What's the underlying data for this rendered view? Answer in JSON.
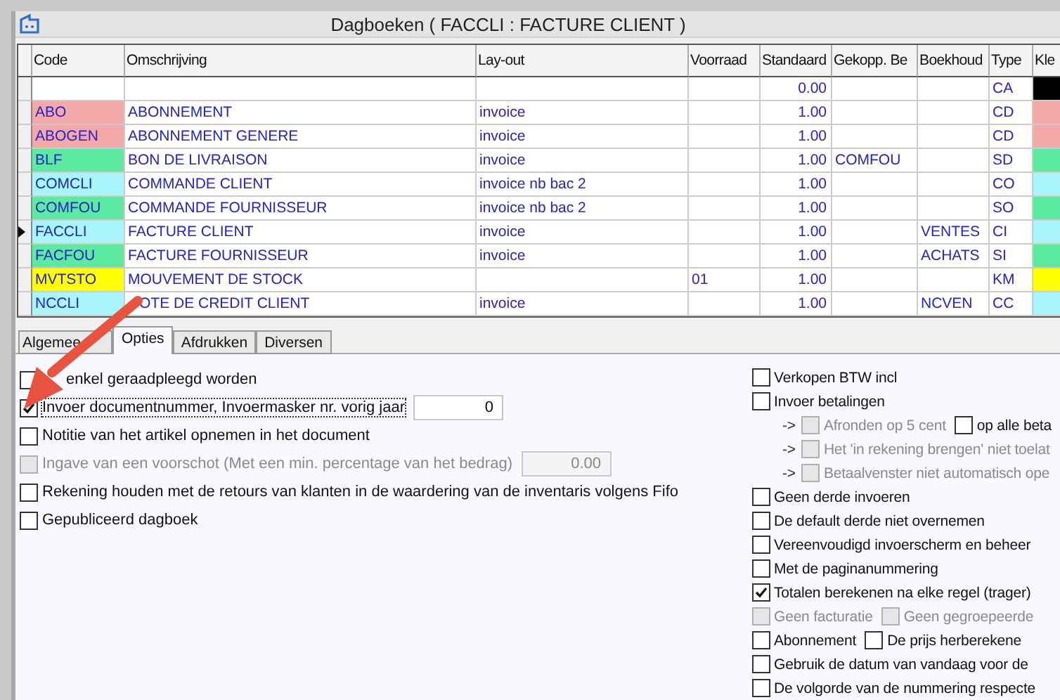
{
  "window": {
    "title": "Dagboeken ( FACCLI : FACTURE CLIENT )"
  },
  "table": {
    "columns": [
      "Code",
      "Omschrijving",
      "Lay-out",
      "Voorraad",
      "Standaard",
      "Gekopp. Be",
      "Boekhoud",
      "Type",
      "Kle"
    ],
    "rows": [
      {
        "code": "",
        "description": "",
        "layout": "",
        "voorraad": "",
        "standaard": "0.00",
        "gekoppeld": "",
        "boekhouding": "",
        "type": "CA",
        "color": "#000000",
        "current": false
      },
      {
        "code": "ABO",
        "description": "ABONNEMENT",
        "layout": "invoice",
        "voorraad": "",
        "standaard": "1.00",
        "gekoppeld": "",
        "boekhouding": "",
        "type": "CD",
        "color": "#f5a8a8",
        "current": false
      },
      {
        "code": "ABOGEN",
        "description": "ABONNEMENT GENERE",
        "layout": "invoice",
        "voorraad": "",
        "standaard": "1.00",
        "gekoppeld": "",
        "boekhouding": "",
        "type": "CD",
        "color": "#f5a8a8",
        "current": false
      },
      {
        "code": "BLF",
        "description": "BON DE LIVRAISON",
        "layout": "invoice",
        "voorraad": "",
        "standaard": "1.00",
        "gekoppeld": "COMFOU",
        "boekhouding": "",
        "type": "SD",
        "color": "#5ceaa0",
        "current": false
      },
      {
        "code": "COMCLI",
        "description": "COMMANDE CLIENT",
        "layout": "invoice nb bac 2",
        "voorraad": "",
        "standaard": "1.00",
        "gekoppeld": "",
        "boekhouding": "",
        "type": "CO",
        "color": "#a8f6fa",
        "current": false
      },
      {
        "code": "COMFOU",
        "description": "COMMANDE FOURNISSEUR",
        "layout": "invoice nb bac 2",
        "voorraad": "",
        "standaard": "1.00",
        "gekoppeld": "",
        "boekhouding": "",
        "type": "SO",
        "color": "#5ceaa0",
        "current": false
      },
      {
        "code": "FACCLI",
        "description": "FACTURE CLIENT",
        "layout": "invoice",
        "voorraad": "",
        "standaard": "1.00",
        "gekoppeld": "",
        "boekhouding": "VENTES",
        "type": "CI",
        "color": "#a8f6fa",
        "current": true
      },
      {
        "code": "FACFOU",
        "description": "FACTURE FOURNISSEUR",
        "layout": "invoice",
        "voorraad": "",
        "standaard": "1.00",
        "gekoppeld": "",
        "boekhouding": "ACHATS",
        "type": "SI",
        "color": "#5ceaa0",
        "current": false
      },
      {
        "code": "MVTSTO",
        "description": "MOUVEMENT DE STOCK",
        "layout": "",
        "voorraad": "01",
        "standaard": "1.00",
        "gekoppeld": "",
        "boekhouding": "",
        "type": "KM",
        "color": "#ffff00",
        "current": false
      },
      {
        "code": "NCCLI",
        "description": "OTE DE CREDIT CLIENT",
        "layout": "invoice",
        "voorraad": "",
        "standaard": "1.00",
        "gekoppeld": "",
        "boekhouding": "NCVEN",
        "type": "CC",
        "color": "#a8f6fa",
        "current": false,
        "lead_hidden": true
      }
    ]
  },
  "tabs": [
    {
      "label": "Algemee",
      "selected": false
    },
    {
      "label": "Opties",
      "selected": true
    },
    {
      "label": "Afdrukken",
      "selected": false
    },
    {
      "label": "Diversen",
      "selected": false
    }
  ],
  "left_options": [
    {
      "label": "enkel geraadpleegd worden",
      "checked": false,
      "disabled": false,
      "lead_hidden": true
    },
    {
      "label": "Invoer documentnummer, Invoermasker nr. vorig jaar",
      "checked": true,
      "disabled": false,
      "focused": true,
      "value": "0"
    },
    {
      "label": "Notitie van het artikel opnemen in het document",
      "checked": false,
      "disabled": false
    },
    {
      "label": "Ingave van een voorschot (Met een min. percentage van het bedrag)",
      "checked": false,
      "disabled": true,
      "value": "0.00"
    },
    {
      "label": "Rekening houden met de retours van klanten in de waardering van de inventaris volgens Fifo",
      "checked": false,
      "disabled": false
    },
    {
      "label": "Gepubliceerd dagboek",
      "checked": false,
      "disabled": false
    }
  ],
  "right_options": [
    {
      "checks": [
        {
          "label": "Verkopen BTW incl",
          "checked": false,
          "disabled": false
        }
      ]
    },
    {
      "checks": [
        {
          "label": "Invoer betalingen",
          "checked": false,
          "disabled": false
        }
      ]
    },
    {
      "prefix": "->",
      "checks": [
        {
          "label": "Afronden op 5 cent",
          "checked": false,
          "disabled": true
        },
        {
          "label": "op alle beta",
          "checked": false,
          "disabled": false
        }
      ]
    },
    {
      "prefix": "->",
      "checks": [
        {
          "label": "Het 'in rekening brengen' niet toelat",
          "checked": false,
          "disabled": true
        }
      ]
    },
    {
      "prefix": "->",
      "checks": [
        {
          "label": "Betaalvenster niet automatisch ope",
          "checked": false,
          "disabled": true
        }
      ]
    },
    {
      "checks": [
        {
          "label": "Geen derde invoeren",
          "checked": false,
          "disabled": false
        }
      ]
    },
    {
      "checks": [
        {
          "label": "De default derde niet overnemen",
          "checked": false,
          "disabled": false
        }
      ]
    },
    {
      "checks": [
        {
          "label": "Vereenvoudigd invoerscherm en beheer",
          "checked": false,
          "disabled": false
        }
      ]
    },
    {
      "checks": [
        {
          "label": "Met de paginanummering",
          "checked": false,
          "disabled": false
        }
      ]
    },
    {
      "checks": [
        {
          "label": "Totalen berekenen na elke regel (trager)",
          "checked": true,
          "disabled": false
        }
      ]
    },
    {
      "checks": [
        {
          "label": "Geen facturatie",
          "checked": false,
          "disabled": true
        },
        {
          "label": "Geen gegroepeerde",
          "checked": false,
          "disabled": true
        }
      ]
    },
    {
      "checks": [
        {
          "label": "Abonnement",
          "checked": false,
          "disabled": false
        },
        {
          "label": "De prijs herberekene",
          "checked": false,
          "disabled": false
        }
      ]
    },
    {
      "checks": [
        {
          "label": "Gebruik de datum van vandaag voor de",
          "checked": false,
          "disabled": false
        }
      ]
    },
    {
      "checks": [
        {
          "label": "De volgorde van de nummering respecte",
          "checked": false,
          "disabled": false
        }
      ]
    }
  ]
}
